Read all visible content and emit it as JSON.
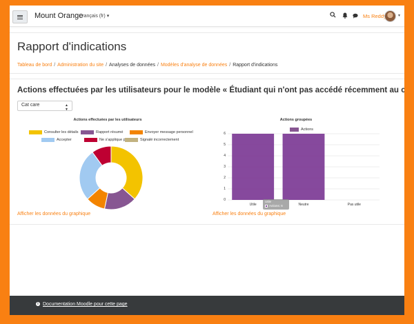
{
  "navbar": {
    "site_name": "Mount Orange",
    "language": "Français (fr)",
    "user_name": "Ms Reddy",
    "icons": [
      "hamburger-icon",
      "search-icon",
      "bell-icon",
      "chat-icon"
    ]
  },
  "header": {
    "title": "Rapport d'indications",
    "breadcrumb": [
      {
        "label": "Tableau de bord",
        "link": true
      },
      {
        "label": "Administration du site",
        "link": true
      },
      {
        "label": "Analyses de données",
        "link": false
      },
      {
        "label": "Modèles d'analyse de données",
        "link": true
      },
      {
        "label": "Rapport d'indications",
        "link": false
      }
    ]
  },
  "main": {
    "heading": "Actions effectuées par les utilisateurs pour le modèle « Étudiant qui n'ont pas accédé récemment au cours »",
    "select_value": "Cat care",
    "show_data_label": "Afficher les données du graphique"
  },
  "chart_data": [
    {
      "type": "pie",
      "title": "Actions effectuées par les utilisateurs",
      "categories": [
        "Consulter les détails",
        "Rapport résumé",
        "Envoyer message personnel",
        "Accepter",
        "Ne s'applique pas",
        "Signalé incorrectement"
      ],
      "values": [
        11,
        5,
        3,
        8,
        3,
        0
      ],
      "colors": [
        "#f3c300",
        "#875692",
        "#f38400",
        "#a1caf1",
        "#be0032",
        "#c2b280"
      ],
      "legend": "top"
    },
    {
      "type": "bar",
      "title": "Actions groupées",
      "categories": [
        "Utile",
        "Neutre",
        "Pas utile"
      ],
      "series": [
        {
          "name": "Actions",
          "values": [
            6,
            6,
            0
          ]
        }
      ],
      "ylim": [
        0,
        6
      ],
      "yticks": [
        0,
        1,
        2,
        3,
        4,
        5,
        6
      ],
      "color": "#7f3f98",
      "legend": "top",
      "tooltip": {
        "category": "Utile",
        "text": "Actions: 6"
      }
    }
  ],
  "footer": {
    "doc_link": "Documentation Moodle pour cette page"
  }
}
